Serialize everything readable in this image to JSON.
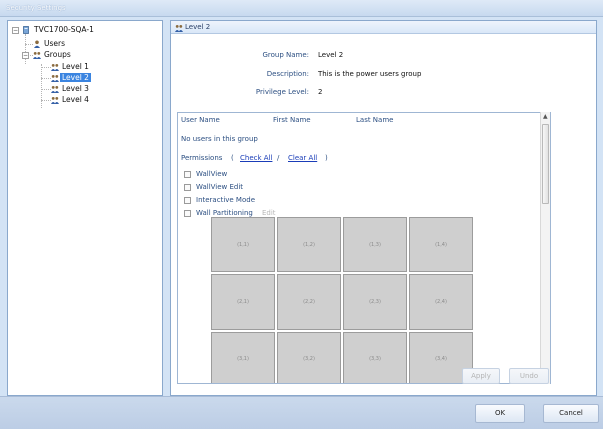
{
  "window": {
    "title": "Security Settings"
  },
  "tree": {
    "root": "TVC1700-SQA-1",
    "users": "Users",
    "groups": "Groups",
    "levels": [
      "Level 1",
      "Level 2",
      "Level 3",
      "Level 4"
    ],
    "selected": "Level 2"
  },
  "panel": {
    "header": "Level 2",
    "group_name_label": "Group Name:",
    "group_name_value": "Level 2",
    "description_label": "Description:",
    "description_value": "This is the power users group",
    "privilege_label": "Privilege Level:",
    "privilege_value": "2"
  },
  "users_table": {
    "columns": [
      "User Name",
      "First Name",
      "Last Name"
    ],
    "empty_text": "No users in this group"
  },
  "permissions": {
    "label": "Permissions",
    "open_paren": "(",
    "check_all": "Check All",
    "separator": "/",
    "clear_all": "Clear All",
    "close_paren": ")",
    "items": [
      "WallView",
      "WallView Edit",
      "Interactive Mode",
      "Wall Partitioning"
    ],
    "edit_label": "Edit"
  },
  "wall_grid": {
    "cells": [
      "(1,1)",
      "(1,2)",
      "(1,3)",
      "(1,4)",
      "(2,1)",
      "(2,2)",
      "(2,3)",
      "(2,4)",
      "(3,1)",
      "(3,2)",
      "(3,3)",
      "(3,4)"
    ]
  },
  "buttons": {
    "apply": "Apply",
    "undo": "Undo",
    "ok": "OK",
    "cancel": "Cancel"
  },
  "colors": {
    "selection": "#3a84e0",
    "label_blue": "#2c4f82",
    "window_bg": "#d3e3f5"
  }
}
